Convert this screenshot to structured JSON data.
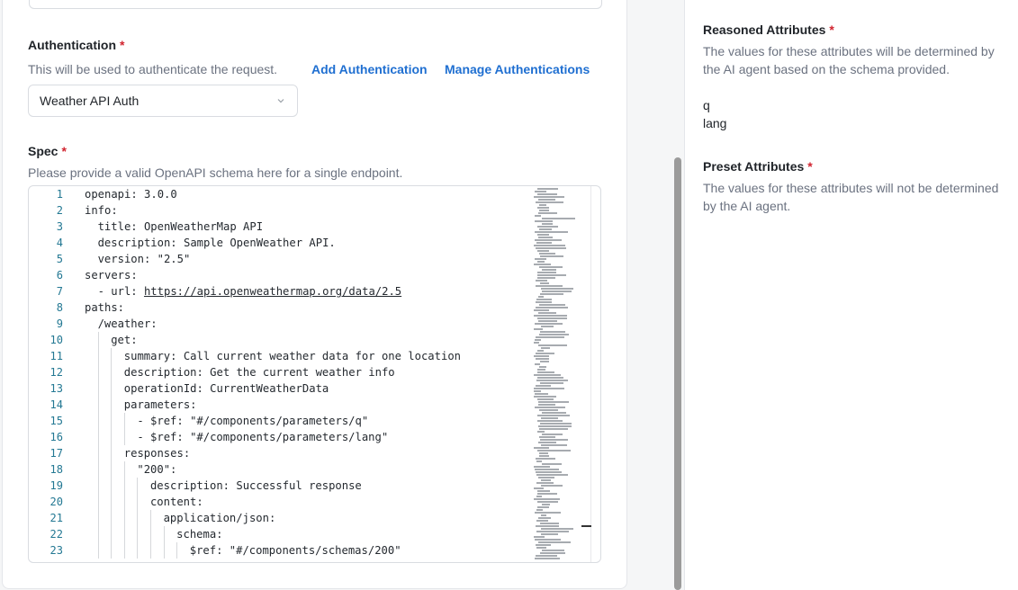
{
  "auth": {
    "label": "Authentication",
    "required_mark": "*",
    "help": "This will be used to authenticate the request.",
    "add_link": "Add Authentication",
    "manage_link": "Manage Authentications",
    "selected": "Weather API Auth"
  },
  "spec": {
    "label": "Spec",
    "required_mark": "*",
    "help": "Please provide a valid OpenAPI schema here for a single endpoint.",
    "lines": [
      {
        "n": "1",
        "indent": 0,
        "text": "openapi: 3.0.0"
      },
      {
        "n": "2",
        "indent": 0,
        "text": "info:"
      },
      {
        "n": "3",
        "indent": 1,
        "text": "title: OpenWeatherMap API"
      },
      {
        "n": "4",
        "indent": 1,
        "text": "description: Sample OpenWeather API."
      },
      {
        "n": "5",
        "indent": 1,
        "text": "version: \"2.5\""
      },
      {
        "n": "6",
        "indent": 0,
        "text": "servers:"
      },
      {
        "n": "7",
        "indent": 1,
        "text": "- url: ",
        "link": "https://api.openweathermap.org/data/2.5"
      },
      {
        "n": "8",
        "indent": 0,
        "text": "paths:"
      },
      {
        "n": "9",
        "indent": 1,
        "text": "/weather:"
      },
      {
        "n": "10",
        "indent": 2,
        "text": "get:"
      },
      {
        "n": "11",
        "indent": 3,
        "text": "summary: Call current weather data for one location"
      },
      {
        "n": "12",
        "indent": 3,
        "text": "description: Get the current weather info"
      },
      {
        "n": "13",
        "indent": 3,
        "text": "operationId: CurrentWeatherData"
      },
      {
        "n": "14",
        "indent": 3,
        "text": "parameters:"
      },
      {
        "n": "15",
        "indent": 4,
        "text": "- $ref: \"#/components/parameters/q\""
      },
      {
        "n": "16",
        "indent": 4,
        "text": "- $ref: \"#/components/parameters/lang\""
      },
      {
        "n": "17",
        "indent": 3,
        "text": "responses:"
      },
      {
        "n": "18",
        "indent": 4,
        "text": "\"200\":"
      },
      {
        "n": "19",
        "indent": 5,
        "text": "description: Successful response"
      },
      {
        "n": "20",
        "indent": 5,
        "text": "content:"
      },
      {
        "n": "21",
        "indent": 6,
        "text": "application/json:"
      },
      {
        "n": "22",
        "indent": 7,
        "text": "schema:"
      },
      {
        "n": "23",
        "indent": 8,
        "text": "$ref: \"#/components/schemas/200\""
      }
    ]
  },
  "right": {
    "reasoned_label": "Reasoned Attributes",
    "reasoned_required": "*",
    "reasoned_help": "The values for these attributes will be determined by the AI agent based on the schema provided.",
    "reasoned_attrs": [
      "q",
      "lang"
    ],
    "preset_label": "Preset Attributes",
    "preset_required": "*",
    "preset_help": "The values for these attributes will not be determined by the AI agent."
  },
  "colors": {
    "link": "#1f6fd1",
    "required": "#d1242f",
    "line_number": "#237893"
  },
  "icons": {
    "select_chevron": "chevron-down-icon"
  }
}
